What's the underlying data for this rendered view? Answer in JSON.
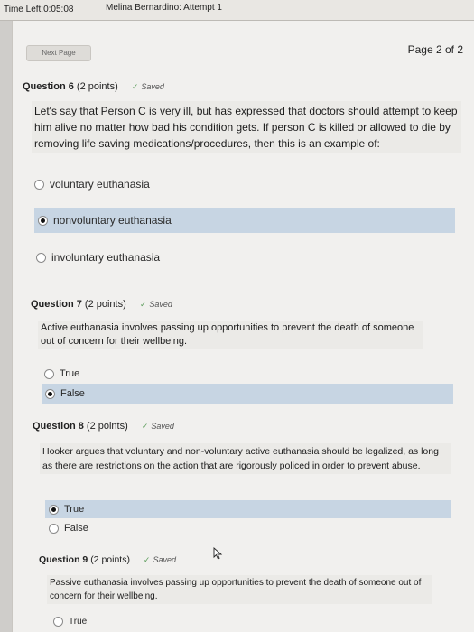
{
  "header": {
    "timer": "Time Left:0:05:08",
    "student": "Melina Bernardino: Attempt 1"
  },
  "nav": {
    "next_page_label": "Next Page",
    "page_indicator": "Page 2 of 2"
  },
  "questions": [
    {
      "number": "Question 6",
      "points": "(2 points)",
      "status": "Saved",
      "text": "Let's say that Person C is very ill, but has expressed that doctors should attempt to keep him alive no matter how bad his condition gets. If person C is killed or allowed to die by removing life saving medications/procedures, then this is an example of:",
      "options": [
        {
          "label": "voluntary euthanasia",
          "selected": false
        },
        {
          "label": "nonvoluntary euthanasia",
          "selected": true
        },
        {
          "label": "involuntary euthanasia",
          "selected": false
        }
      ]
    },
    {
      "number": "Question 7",
      "points": "(2 points)",
      "status": "Saved",
      "text": "Active euthanasia involves passing up opportunities to prevent the death of someone out of concern for their wellbeing.",
      "options": [
        {
          "label": "True",
          "selected": false
        },
        {
          "label": "False",
          "selected": true
        }
      ]
    },
    {
      "number": "Question 8",
      "points": "(2 points)",
      "status": "Saved",
      "text": "Hooker argues that voluntary and non-voluntary active euthanasia should be legalized, as long as there are restrictions on the action that are rigorously policed in order to prevent abuse.",
      "options": [
        {
          "label": "True",
          "selected": true
        },
        {
          "label": "False",
          "selected": false
        }
      ]
    },
    {
      "number": "Question 9",
      "points": "(2 points)",
      "status": "Saved",
      "text": "Passive euthanasia involves passing up opportunities to prevent the death of someone out of concern for their wellbeing.",
      "options": [
        {
          "label": "True",
          "selected": false
        }
      ]
    }
  ]
}
